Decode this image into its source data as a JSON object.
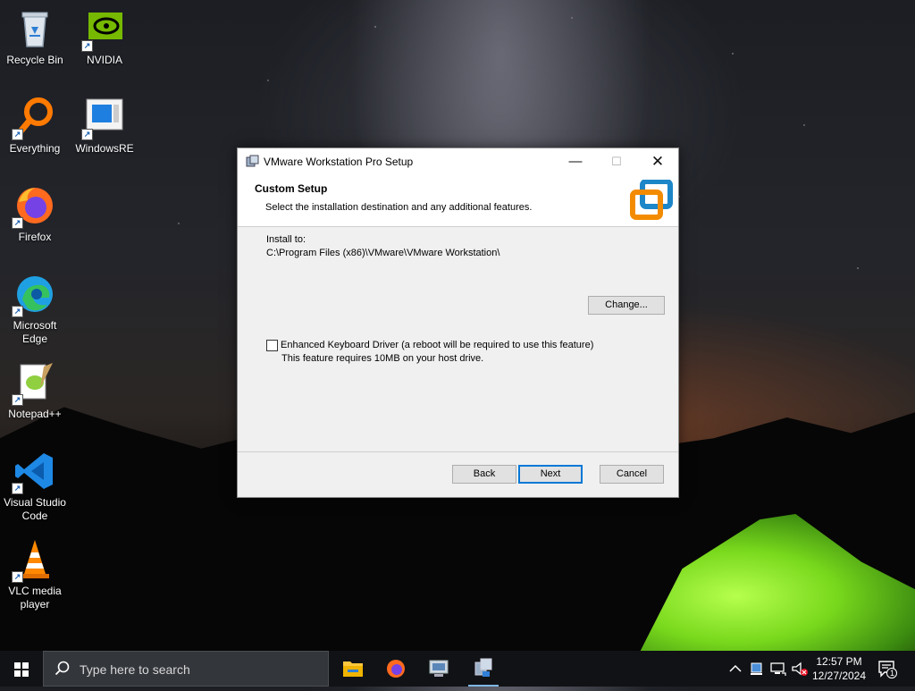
{
  "desktop": {
    "icons": [
      {
        "label": "Recycle Bin"
      },
      {
        "label": "NVIDIA"
      },
      {
        "label": "Everything"
      },
      {
        "label": "WindowsRE"
      },
      {
        "label": "Firefox"
      },
      {
        "label": "Microsoft Edge"
      },
      {
        "label": "Notepad++"
      },
      {
        "label": "Visual Studio Code"
      },
      {
        "label": "VLC media player"
      }
    ]
  },
  "dialog": {
    "title": "VMware Workstation Pro Setup",
    "header_title": "Custom Setup",
    "header_subtitle": "Select the installation destination and any additional features.",
    "install_to_label": "Install to:",
    "install_path": "C:\\Program Files (x86)\\VMware\\VMware Workstation\\",
    "change_button": "Change...",
    "feature_label": "Enhanced Keyboard Driver (a reboot will be required to use this feature)",
    "feature_checked": false,
    "feature_note": "This feature requires 10MB on your host drive.",
    "back_button": "Back",
    "next_button": "Next",
    "cancel_button": "Cancel"
  },
  "taskbar": {
    "search_placeholder": "Type here to search",
    "time": "12:57 PM",
    "date": "12/27/2024",
    "notification_count": "1"
  },
  "colors": {
    "accent": "#0078d7",
    "vmware_orange": "#f38b00",
    "vmware_blue": "#1d86c8",
    "tent_green": "#78d81c"
  }
}
